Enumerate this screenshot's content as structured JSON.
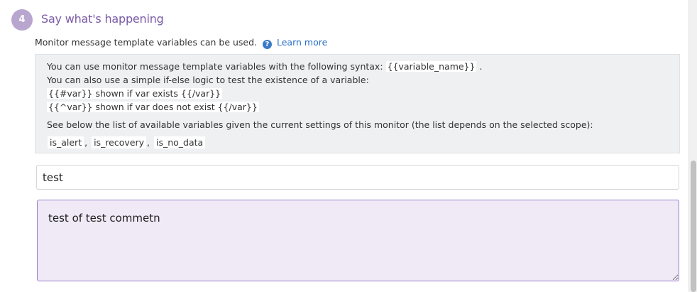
{
  "step": {
    "number": "4",
    "title": "Say what's happening",
    "badge_color": "#b9a6cf",
    "title_color": "#7a5aa6"
  },
  "subtitle": {
    "text": "Monitor message template variables can be used.",
    "help_icon": "question-circle-icon",
    "help_glyph": "?",
    "learn_more_label": "Learn more"
  },
  "info": {
    "line1_prefix": "You can use monitor message template variables with the following syntax:",
    "line1_code": "{{variable_name}}",
    "line1_suffix": ".",
    "line2": "You can also use a simple if-else logic to test the existence of a variable:",
    "line3": "{{#var}} shown if var exists {{/var}}",
    "line4": "{{^var}} shown if var does not exist {{/var}}",
    "line5": "See below the list of available variables given the current settings of this monitor (the list depends on the selected scope):",
    "variables": [
      "is_alert",
      "is_recovery",
      "is_no_data"
    ],
    "separator": ","
  },
  "title_input": {
    "value": "test"
  },
  "message_input": {
    "value": "test of test commetn",
    "accent_color": "#9b7fc7"
  }
}
